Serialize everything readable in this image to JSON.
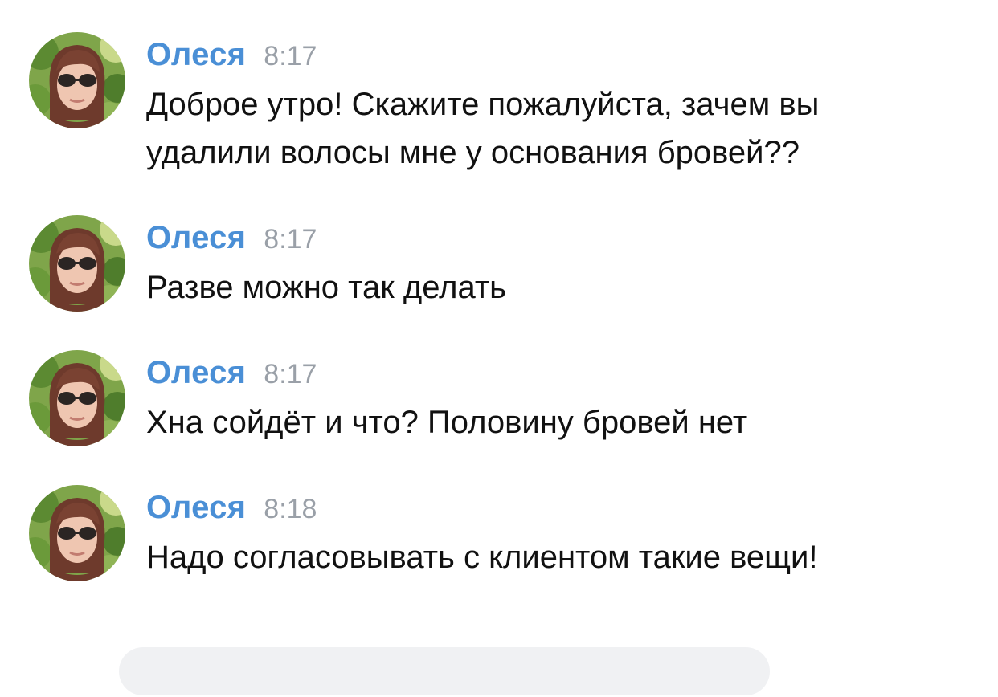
{
  "messages": [
    {
      "author": "Олеся",
      "time": "8:17",
      "text": "Доброе утро! Скажите пожалуйста, зачем вы удалили волосы мне у основания бровей??"
    },
    {
      "author": "Олеся",
      "time": "8:17",
      "text": "Разве можно так делать"
    },
    {
      "author": "Олеся",
      "time": "8:17",
      "text": "Хна сойдёт и что? Половину бровей нет"
    },
    {
      "author": "Олеся",
      "time": "8:18",
      "text": "Надо согласовывать с клиентом такие вещи!"
    }
  ],
  "colors": {
    "author_name": "#4a8fd6",
    "timestamp": "#9aa0a8",
    "message_text": "#111111",
    "composer_background": "#f0f1f3"
  },
  "icons": {
    "avatar": "user-photo-avatar"
  }
}
